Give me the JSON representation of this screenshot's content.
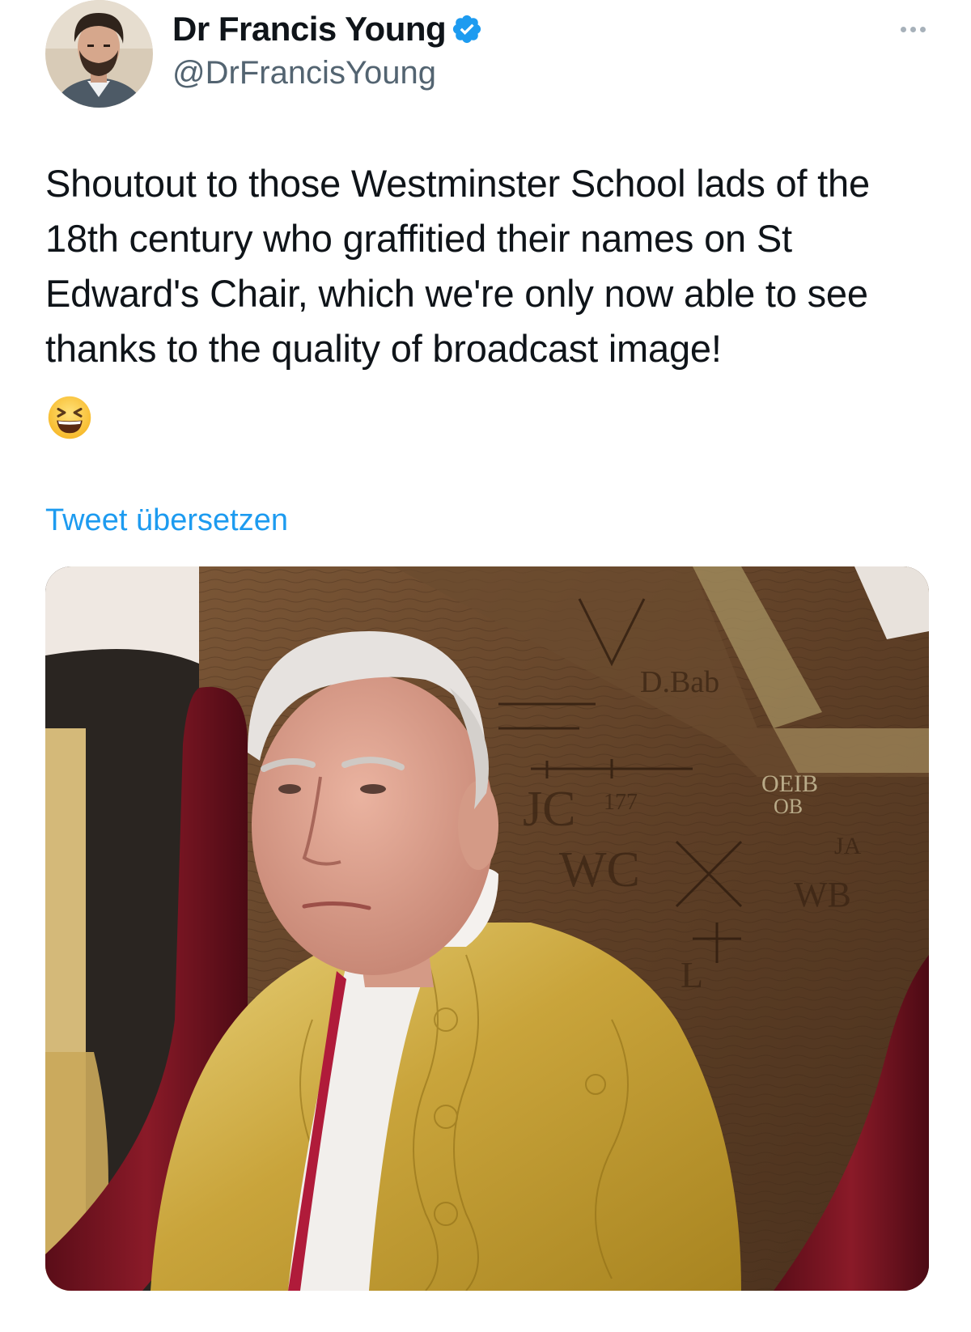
{
  "author": {
    "display_name": "Dr Francis Young",
    "handle": "@DrFrancisYoung",
    "verified_icon": "verified-badge-icon",
    "avatar_icon": "profile-photo"
  },
  "header": {
    "more_icon": "more-options-icon"
  },
  "tweet": {
    "text": "Shoutout to those Westminster School lads of the 18th century who graffitied their names on St Edward's Chair, which we're only now able to see thanks to the quality of broadcast image!",
    "emoji": "grinning-squinting-face-emoji",
    "translate_label": "Tweet übersetzen"
  },
  "media": {
    "description_icon": "attached-photo",
    "carved_graffiti": [
      "D.Bab",
      "JC",
      "WC",
      "OEIB",
      "OB",
      "JA",
      "WB",
      "L",
      "177",
      "1"
    ]
  },
  "colors": {
    "link": "#1d9bf0",
    "secondary_text": "#536471",
    "primary_text": "#0f1419",
    "verified": "#1d9bf0"
  }
}
